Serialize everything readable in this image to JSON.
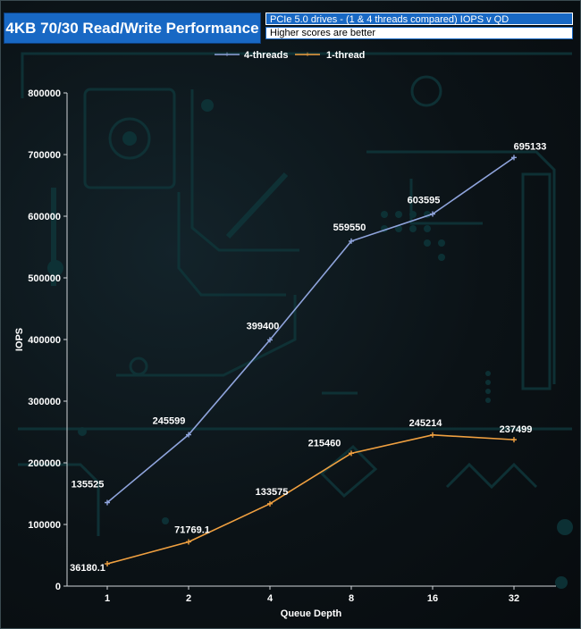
{
  "chart_data": {
    "type": "line",
    "title": "4KB 70/30 Read/Write Performance",
    "subtitle": "PCIe 5.0 drives - (1 & 4 threads compared) IOPS v QD",
    "note": "Higher scores are better",
    "xlabel": "Queue Depth",
    "ylabel": "IOPS",
    "categories": [
      "1",
      "2",
      "4",
      "8",
      "16",
      "32"
    ],
    "ylim": [
      0,
      800000
    ],
    "yticks": [
      0,
      100000,
      200000,
      300000,
      400000,
      500000,
      600000,
      700000,
      800000
    ],
    "grid": false,
    "legend": "top-center",
    "series": [
      {
        "name": "4-threads",
        "color": "#8fa4dc",
        "values": [
          135525,
          245599,
          399400,
          559550,
          603595,
          695133
        ],
        "labels": [
          "135525",
          "245599",
          "399400",
          "559550",
          "603595",
          "695133"
        ]
      },
      {
        "name": "1-thread",
        "color": "#f0a040",
        "values": [
          36180.1,
          71769.1,
          133575,
          215460,
          245214,
          237499
        ],
        "labels": [
          "36180.1",
          "71769.1",
          "133575",
          "215460",
          "245214",
          "237499"
        ]
      }
    ]
  }
}
